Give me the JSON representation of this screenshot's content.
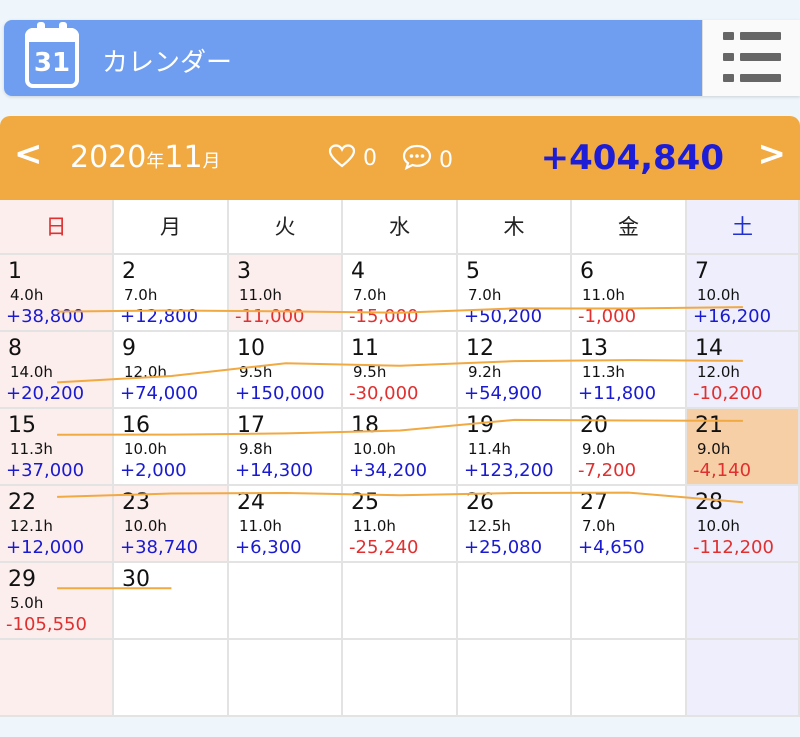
{
  "header": {
    "icon_day": "31",
    "title": "カレンダー",
    "menu_icon": "list-icon",
    "bg_color": "#6f9ef1"
  },
  "month_bar": {
    "prev": "<",
    "next": ">",
    "year": "2020",
    "year_unit": "年",
    "month": "11",
    "month_unit": "月",
    "likes": "0",
    "comments": "0",
    "total": "+404,840",
    "bg_color": "#f1a942"
  },
  "weekdays": [
    "日",
    "月",
    "火",
    "水",
    "木",
    "金",
    "土"
  ],
  "days": [
    {
      "day": "1",
      "hours": "4.0h",
      "amount": "+38,800"
    },
    {
      "day": "2",
      "hours": "7.0h",
      "amount": "+12,800"
    },
    {
      "day": "3",
      "hours": "11.0h",
      "amount": "-11,000"
    },
    {
      "day": "4",
      "hours": "7.0h",
      "amount": "-15,000"
    },
    {
      "day": "5",
      "hours": "7.0h",
      "amount": "+50,200"
    },
    {
      "day": "6",
      "hours": "11.0h",
      "amount": "-1,000"
    },
    {
      "day": "7",
      "hours": "10.0h",
      "amount": "+16,200"
    },
    {
      "day": "8",
      "hours": "14.0h",
      "amount": "+20,200"
    },
    {
      "day": "9",
      "hours": "12.0h",
      "amount": "+74,000"
    },
    {
      "day": "10",
      "hours": "9.5h",
      "amount": "+150,000"
    },
    {
      "day": "11",
      "hours": "9.5h",
      "amount": "-30,000"
    },
    {
      "day": "12",
      "hours": "9.2h",
      "amount": "+54,900"
    },
    {
      "day": "13",
      "hours": "11.3h",
      "amount": "+11,800"
    },
    {
      "day": "14",
      "hours": "12.0h",
      "amount": "-10,200"
    },
    {
      "day": "15",
      "hours": "11.3h",
      "amount": "+37,000"
    },
    {
      "day": "16",
      "hours": "10.0h",
      "amount": "+2,000"
    },
    {
      "day": "17",
      "hours": "9.8h",
      "amount": "+14,300"
    },
    {
      "day": "18",
      "hours": "10.0h",
      "amount": "+34,200"
    },
    {
      "day": "19",
      "hours": "11.4h",
      "amount": "+123,200"
    },
    {
      "day": "20",
      "hours": "9.0h",
      "amount": "-7,200"
    },
    {
      "day": "21",
      "hours": "9.0h",
      "amount": "-4,140"
    },
    {
      "day": "22",
      "hours": "12.1h",
      "amount": "+12,000"
    },
    {
      "day": "23",
      "hours": "10.0h",
      "amount": "+38,740"
    },
    {
      "day": "24",
      "hours": "11.0h",
      "amount": "+6,300"
    },
    {
      "day": "25",
      "hours": "11.0h",
      "amount": "-25,240"
    },
    {
      "day": "26",
      "hours": "12.5h",
      "amount": "+25,080"
    },
    {
      "day": "27",
      "hours": "7.0h",
      "amount": "+4,650"
    },
    {
      "day": "28",
      "hours": "10.0h",
      "amount": "-112,200"
    },
    {
      "day": "29",
      "hours": "5.0h",
      "amount": "-105,550"
    },
    {
      "day": "30",
      "hours": "",
      "amount": ""
    }
  ],
  "holidays": [
    "3",
    "23"
  ],
  "today": "21",
  "colors": {
    "positive": "#1a1ad0",
    "negative": "#e03030",
    "line": "#f1a942",
    "today_bg": "#f6cfa6"
  }
}
